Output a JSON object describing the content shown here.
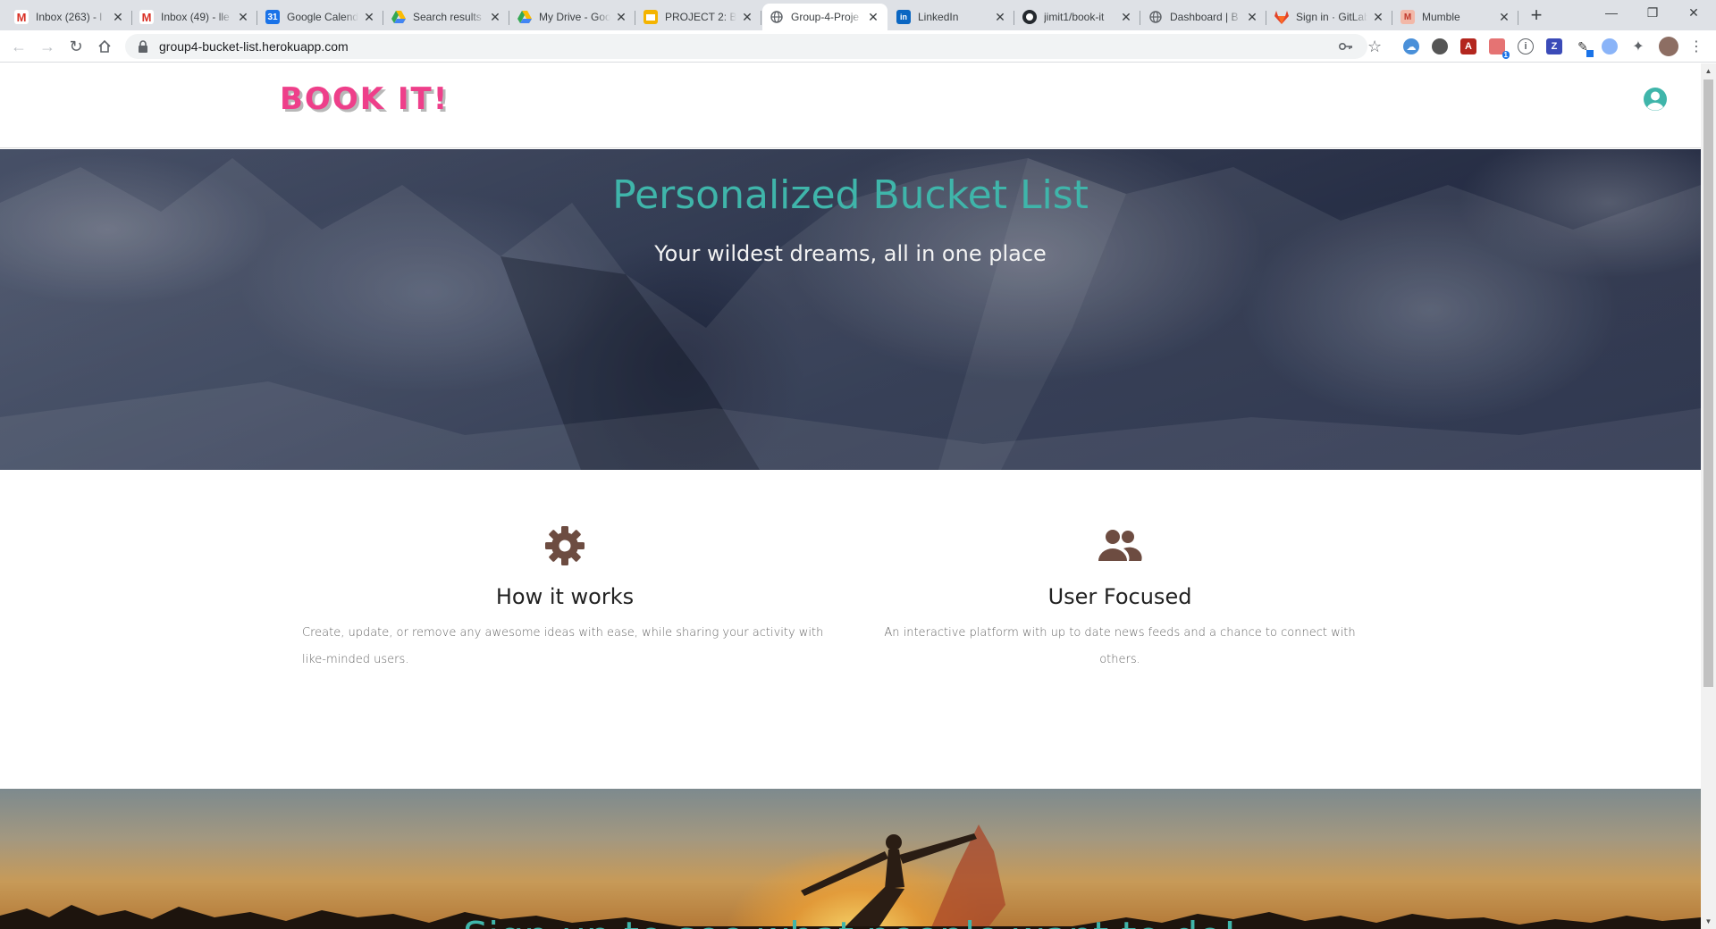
{
  "browser": {
    "tabs": [
      {
        "title": "Inbox (263) - l",
        "favicon": "gmail-icon",
        "color": "#d93025",
        "active": false
      },
      {
        "title": "Inbox (49) - lle",
        "favicon": "gmail-icon",
        "color": "#d93025",
        "active": false
      },
      {
        "title": "Google Calenda",
        "favicon": "google-calendar-icon",
        "color": "#1a73e8",
        "active": false
      },
      {
        "title": "Search results",
        "favicon": "google-drive-icon",
        "color": "#34a853",
        "active": false
      },
      {
        "title": "My Drive - Goo",
        "favicon": "google-drive-icon",
        "color": "#34a853",
        "active": false
      },
      {
        "title": "PROJECT 2: Bo",
        "favicon": "google-slides-icon",
        "color": "#f4b400",
        "active": false
      },
      {
        "title": "Group-4-Proje",
        "favicon": "globe-icon",
        "color": "#5f6368",
        "active": true
      },
      {
        "title": "LinkedIn",
        "favicon": "linkedin-icon",
        "color": "#0a66c2",
        "active": false
      },
      {
        "title": "jimit1/book-it",
        "favicon": "github-icon",
        "color": "#24292e",
        "active": false
      },
      {
        "title": "Dashboard | B",
        "favicon": "globe-icon",
        "color": "#5f6368",
        "active": false
      },
      {
        "title": "Sign in · GitLab",
        "favicon": "gitlab-icon",
        "color": "#e24329",
        "active": false
      },
      {
        "title": "Mumble",
        "favicon": "mumble-icon",
        "color": "#e8a0a0",
        "active": false
      }
    ],
    "url": "group4-bucket-list.herokuapp.com",
    "extension_badge": "1"
  },
  "site": {
    "logo": "BOOK IT!",
    "hero_title": "Personalized Bucket List",
    "hero_subtitle": "Your wildest dreams, all in one place",
    "features": [
      {
        "icon": "gear-icon",
        "title": "How it works",
        "text": "Create, update, or remove any awesome ideas with ease, while sharing your activity with like-minded users."
      },
      {
        "icon": "users-icon",
        "title": "User Focused",
        "text": "An interactive platform with up to date news feeds and a chance to connect with others."
      }
    ],
    "signup_text": "Sign up to see what people want to do!"
  },
  "colors": {
    "accent_teal": "#3fb5aa",
    "logo_pink": "#ee3f8a",
    "icon_brown": "#6d4c41"
  }
}
